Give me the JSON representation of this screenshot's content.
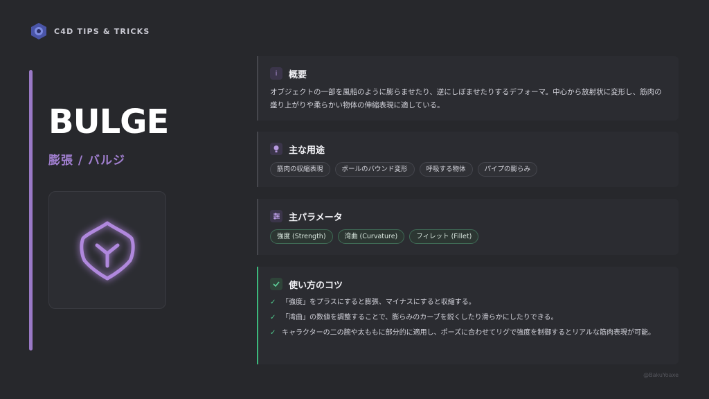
{
  "brand": {
    "name": "C4D TIPS & TRICKS",
    "logo_icon": "cinema4d-logo-icon"
  },
  "title": "BULGE",
  "subtitle": "膨張 / バルジ",
  "hero_icon": "bulge-deformer-icon",
  "overview": {
    "icon": "info-icon",
    "icon_glyph": "i",
    "heading": "概要",
    "text": "オブジェクトの一部を風船のように膨らませたり、逆にしぼませたりするデフォーマ。中心から放射状に変形し、筋肉の盛り上がりや柔らかい物体の伸縮表現に適している。"
  },
  "uses": {
    "icon": "lightbulb-icon",
    "heading": "主な用途",
    "tags": [
      "筋肉の収縮表現",
      "ボールのバウンド変形",
      "呼吸する物体",
      "パイプの膨らみ"
    ]
  },
  "params": {
    "icon": "sliders-icon",
    "heading": "主パラメータ",
    "tags": [
      "強度 (Strength)",
      "湾曲 (Curvature)",
      "フィレット (Fillet)"
    ]
  },
  "tips": {
    "icon": "check-icon",
    "heading": "使い方のコツ",
    "items": [
      "「強度」をプラスにすると膨張、マイナスにすると収縮する。",
      "「湾曲」の数値を調整することで、膨らみのカーブを鋭くしたり滑らかにしたりできる。",
      "キャラクターの二の腕や太ももに部分的に適用し、ポーズに合わせてリグで強度を制御するとリアルな筋肉表現が可能。"
    ]
  },
  "credit": "@BakuYoaxe",
  "colors": {
    "accent": "#9a79c6",
    "tip_accent": "#3cb97c",
    "background": "#27282c"
  }
}
